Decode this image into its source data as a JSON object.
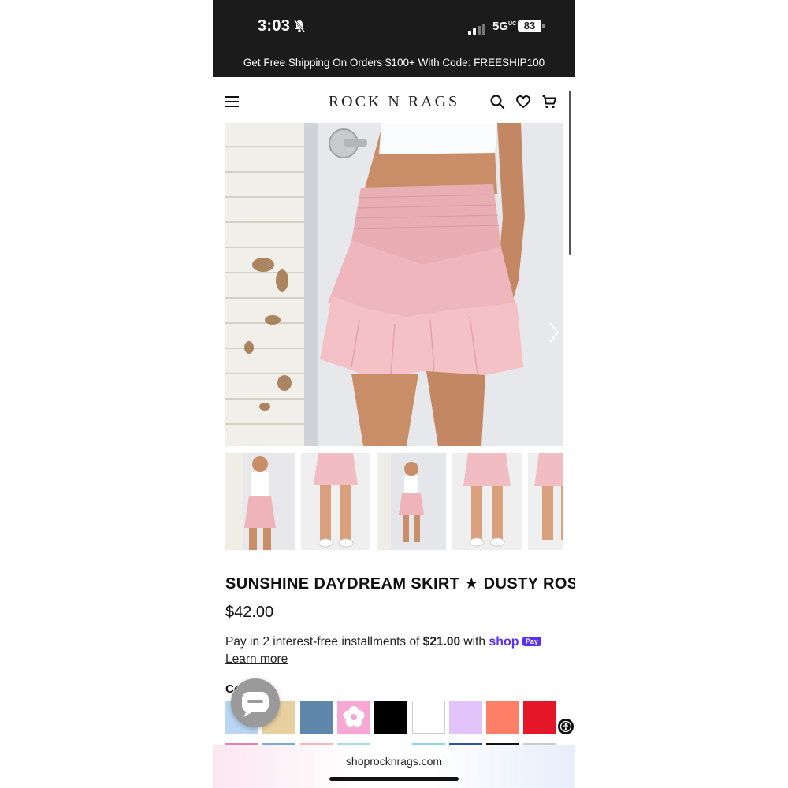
{
  "status_bar": {
    "time": "3:03",
    "network": "5G",
    "network_sub": "UC",
    "battery": "83"
  },
  "promo_banner": "Get Free Shipping On Orders $100+ With Code: FREESHIP100",
  "header": {
    "logo": "ROCK N RAGS"
  },
  "icons": {
    "menu": "hamburger-icon",
    "search": "search-icon",
    "wishlist": "heart-icon",
    "cart": "cart-icon"
  },
  "product": {
    "title": "SUNSHINE DAYDREAM SKIRT ★ DUSTY ROSE",
    "price": "$42.00",
    "installments_prefix": "Pay in 2 interest-free installments of ",
    "installment_amount": "$21.00",
    "installments_suffix": " with ",
    "shop_word": "shop",
    "pay_badge": "Pay",
    "learn_more": "Learn more",
    "color_label": "Co"
  },
  "swatches": [
    "#b9d6f3",
    "#e8cfa0",
    "#5f86ab",
    "#f7a7d3",
    "#000000",
    "#ffffff",
    "#e2c4fb",
    "#ff7f66",
    "#e51628"
  ],
  "swatch_row2": [
    "#e77fb1",
    "#7fa8d9",
    "#f2b5c0",
    "#a8e0d6",
    "#ffffff",
    "#8fd4ea",
    "#2f54a3",
    "#111111",
    "#cccccc"
  ],
  "browser": {
    "url": "shoprocknrags.com"
  }
}
